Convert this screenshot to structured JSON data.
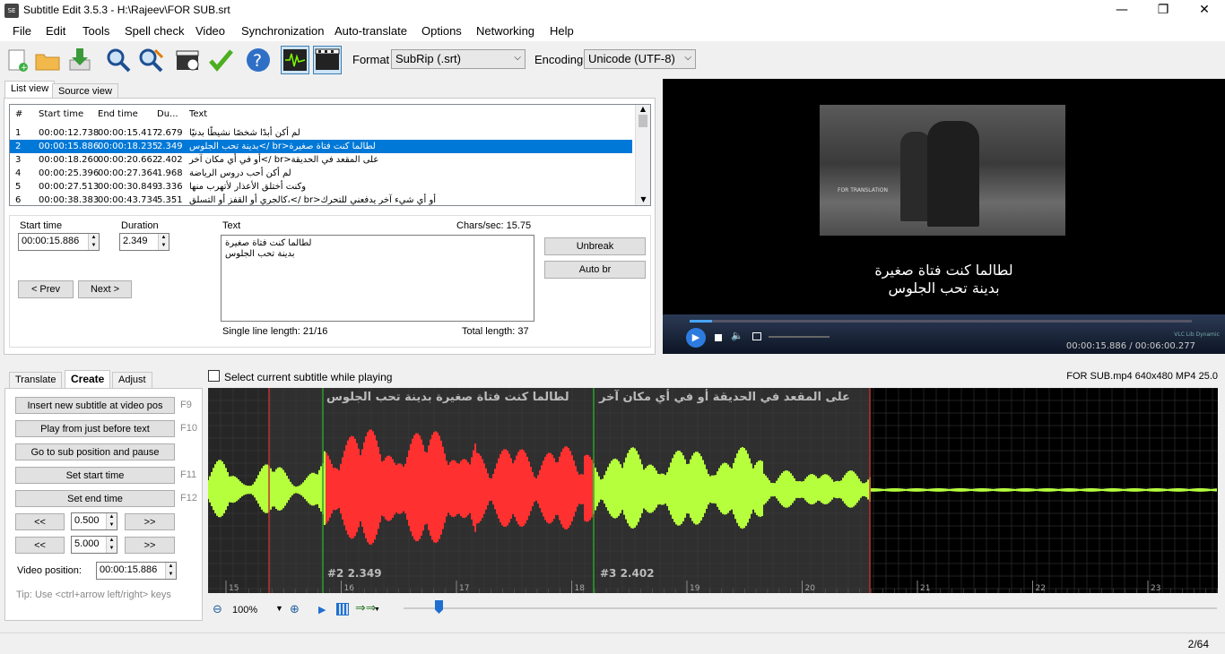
{
  "window": {
    "title": "Subtitle Edit 3.5.3 - H:\\Rajeev\\FOR SUB.srt",
    "app_icon": "SE"
  },
  "menu": [
    "File",
    "Edit",
    "Tools",
    "Spell check",
    "Video",
    "Synchronization",
    "Auto-translate",
    "Options",
    "Networking",
    "Help"
  ],
  "toolbar": {
    "format_label": "Format",
    "format_value": "SubRip (.srt)",
    "encoding_label": "Encoding",
    "encoding_value": "Unicode (UTF-8)"
  },
  "tabs": {
    "list_view": "List view",
    "source_view": "Source view"
  },
  "grid": {
    "headers": [
      "#",
      "Start time",
      "End time",
      "Du...",
      "Text"
    ],
    "rows": [
      {
        "n": "1",
        "start": "00:00:12.738",
        "end": "00:00:15.417",
        "dur": "2.679",
        "text": "لم أكن أبدًا شخصًا نشيطًا بدنيًا"
      },
      {
        "n": "2",
        "start": "00:00:15.886",
        "end": "00:00:18.235",
        "dur": "2.349",
        "text": "لطالما كنت فتاة صغيرة<br />بدينة تحب الجلوس"
      },
      {
        "n": "3",
        "start": "00:00:18.260",
        "end": "00:00:20.662",
        "dur": "2.402",
        "text": "على المقعد في الحديقة<br />أو في أي مكان آخر"
      },
      {
        "n": "4",
        "start": "00:00:25.396",
        "end": "00:00:27.364",
        "dur": "1.968",
        "text": "لم أكن أحب دروس الرياضة"
      },
      {
        "n": "5",
        "start": "00:00:27.513",
        "end": "00:00:30.849",
        "dur": "3.336",
        "text": "وكنت أختلق الأعذار لأتهرب منها"
      },
      {
        "n": "6",
        "start": "00:00:38.383",
        "end": "00:00:43.734",
        "dur": "5.351",
        "text": "أو أي شيء آخر يدفعني للتحرك<br />،كالجري أو القفز أو التسلق"
      }
    ],
    "selected_index": 1
  },
  "editor": {
    "start_time_label": "Start time",
    "start_time_value": "00:00:15.886",
    "duration_label": "Duration",
    "duration_value": "2.349",
    "text_label": "Text",
    "chars_sec": "Chars/sec: 15.75",
    "text_line1": "لطالما كنت فتاة صغيرة",
    "text_line2": "بدينة تحب الجلوس",
    "unbreak": "Unbreak",
    "auto_br": "Auto br",
    "prev": "< Prev",
    "next": "Next >",
    "single_line": "Single line length:  21/16",
    "total_length": "Total length: 37"
  },
  "video": {
    "frame_text": "FOR TRANSLATION",
    "subtitle_line1": "لطالما كنت فتاة صغيرة",
    "subtitle_line2": "بدينة تحب الجلوس",
    "brand": "VLC Lib Dynamic",
    "time": "00:00:15.886 / 00:06:00.277",
    "progress": 0.044
  },
  "bottom_tabs": {
    "translate": "Translate",
    "create": "Create",
    "adjust": "Adjust"
  },
  "select_while_playing": "Select current subtitle while playing",
  "media_info": "FOR SUB.mp4 640x480 MP4 25.0",
  "create": {
    "insert": "Insert new subtitle at video pos",
    "insert_key": "F9",
    "play_before": "Play from just before text",
    "play_before_key": "F10",
    "goto_pause": "Go to sub position and pause",
    "set_start": "Set start time",
    "set_start_key": "F11",
    "set_end": "Set end time",
    "set_end_key": "F12",
    "back": "<<",
    "forward": ">>",
    "step1": "0.500",
    "step2": "5.000",
    "video_position_label": "Video position:",
    "video_position_value": "00:00:15.886",
    "tip": "Tip: Use <ctrl+arrow left/right> keys"
  },
  "waveform": {
    "sub2_text": "لطالما كنت فتاة صغيرة  بدينة تحب الجلوس",
    "sub3_text": "على المقعد في الحديقة  أو في أي مكان آخر",
    "sub2_label": "#2  2.349",
    "sub3_label": "#3  2.402",
    "ticks": [
      "15",
      "16",
      "17",
      "18",
      "19",
      "20",
      "21",
      "22",
      "23"
    ],
    "zoom": "100%"
  },
  "status": {
    "position": "2/64"
  },
  "colors": {
    "selected": "#0078d7",
    "wave_active": "#ff3030",
    "wave_normal": "#b6ff3c"
  }
}
